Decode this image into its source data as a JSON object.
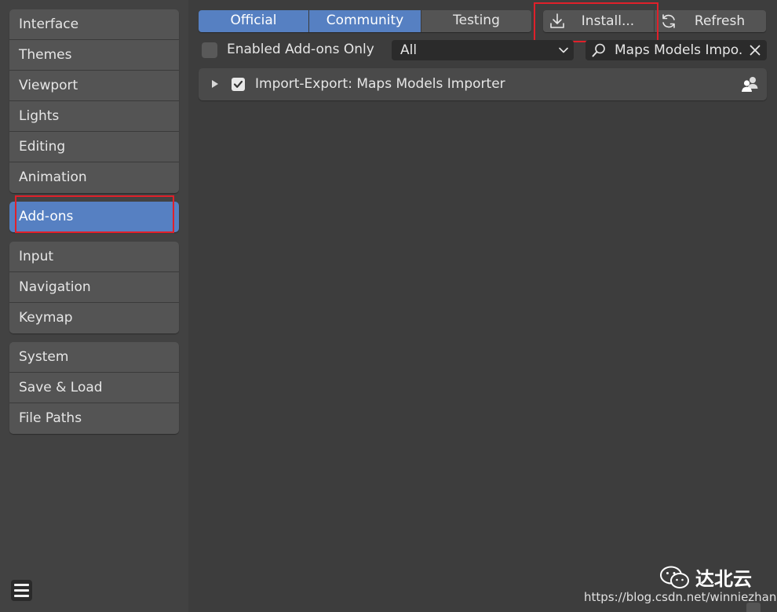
{
  "sidebar": {
    "group1": [
      "Interface",
      "Themes",
      "Viewport",
      "Lights",
      "Editing",
      "Animation"
    ],
    "active": "Add-ons",
    "group3": [
      "Input",
      "Navigation",
      "Keymap"
    ],
    "group4": [
      "System",
      "Save & Load",
      "File Paths"
    ]
  },
  "tabs": [
    {
      "label": "Official",
      "active": true
    },
    {
      "label": "Community",
      "active": true
    },
    {
      "label": "Testing",
      "active": false
    }
  ],
  "toolbar": {
    "install_label": "Install...",
    "refresh_label": "Refresh",
    "install_icon": "download-icon",
    "refresh_icon": "refresh-icon"
  },
  "filters": {
    "enabled_only_label": "Enabled Add-ons Only",
    "category_value": "All",
    "search_value": "Maps Models Impo..."
  },
  "addons": [
    {
      "name": "Import-Export: Maps Models Importer",
      "enabled": true,
      "icon": "community-users-icon"
    }
  ],
  "watermark": {
    "name": "达北云",
    "url": "https://blog.csdn.net/winniezhang"
  },
  "colors": {
    "accent": "#5680c2",
    "highlight_box": "#e0202a",
    "background": "#3d3d3d",
    "button": "#545454"
  }
}
